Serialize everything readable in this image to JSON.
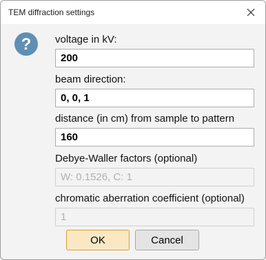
{
  "window": {
    "title": "TEM diffraction settings",
    "close_icon": "close-icon"
  },
  "dialog": {
    "icon": "question-icon",
    "icon_color": "#5f8fb4",
    "fields": [
      {
        "label": "voltage in kV:",
        "value": "200",
        "enabled": true
      },
      {
        "label": "beam direction:",
        "value": "0, 0, 1",
        "enabled": true
      },
      {
        "label": "distance (in cm) from sample to pattern",
        "value": "160",
        "enabled": true
      },
      {
        "label": "Debye-Waller factors (optional)",
        "value": "",
        "placeholder": "W: 0.1526, C: 1",
        "enabled": false
      },
      {
        "label": "chromatic aberration coefficient (optional)",
        "value": "",
        "placeholder": "1",
        "enabled": false
      }
    ]
  },
  "buttons": {
    "ok_label": "OK",
    "cancel_label": "Cancel",
    "ok_accent": "#d89f33"
  }
}
